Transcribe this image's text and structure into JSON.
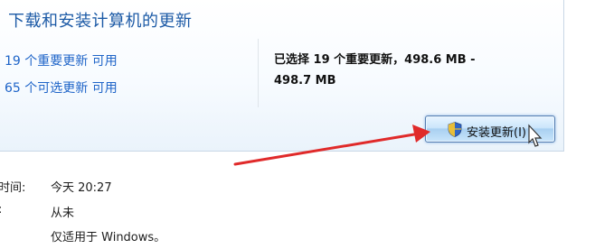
{
  "header": {
    "title": "下载和安装计算机的更新"
  },
  "updates": {
    "important_link": "19 个重要更新 可用",
    "optional_link": "65 个可选更新 可用"
  },
  "summary": {
    "line1": "已选择 19 个重要更新，498.6 MB -",
    "line2": "498.7 MB"
  },
  "install_button": {
    "label": "安装更新(I)"
  },
  "info": {
    "last_check_label": "时间:",
    "last_check_value": "今天 20:27",
    "installed_label": ":",
    "installed_value": "从未",
    "applies_to": "仅适用于 Windows。"
  },
  "colors": {
    "title": "#1c5aa6",
    "link": "#1e64c8",
    "annotation_arrow": "#e02a2a",
    "button_border": "#567eb1"
  }
}
